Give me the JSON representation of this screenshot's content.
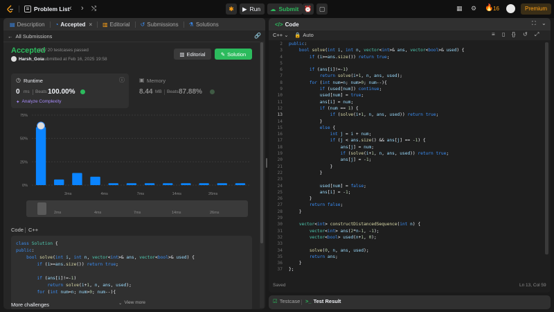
{
  "nav": {
    "problem_list": "Problem List",
    "run": "Run",
    "submit": "Submit",
    "streak": "16",
    "premium": "Premium"
  },
  "left_tabs": [
    {
      "label": "Description"
    },
    {
      "label": "Accepted"
    },
    {
      "label": "Editorial"
    },
    {
      "label": "Submissions"
    },
    {
      "label": "Solutions"
    }
  ],
  "submission": {
    "back_label": "All Submissions",
    "status": "Accepted",
    "testcases": "20 / 20 testcases passed",
    "user": "Harsh_Goia",
    "submitted_at": "submitted at Feb 16, 2025 19:58",
    "editorial_btn": "Editorial",
    "solution_btn": "Solution",
    "runtime_label": "Runtime",
    "runtime_value": "0",
    "runtime_unit": "ms",
    "beats_label": "Beats",
    "runtime_beats": "100.00%",
    "analyze": "Analyze Complexity",
    "memory_label": "Memory",
    "memory_value": "8.44",
    "memory_unit": "MB",
    "memory_beats": "87.88%"
  },
  "chart_data": {
    "type": "bar",
    "yticks": [
      "75%",
      "50%",
      "25%",
      "0%"
    ],
    "ylim": [
      0,
      75
    ],
    "values": [
      62,
      6,
      13,
      9,
      2,
      2,
      2,
      2,
      2,
      2,
      2,
      2
    ],
    "xtick_labels": [
      "2ms",
      "4ms",
      "7ms",
      "14ms",
      "26ms"
    ],
    "highlight_index": 0,
    "bar_color": "#0a84ff"
  },
  "mini_chart": {
    "labels": [
      "2ms",
      "4ms",
      "7ms",
      "14ms",
      "26ms"
    ]
  },
  "code_section": {
    "label": "Code",
    "lang": "C++",
    "view_more": "View more",
    "more_challenges": "More challenges"
  },
  "preview_lines": [
    "class Solution {",
    "public:",
    "    bool solve(int i, int n, vector<int>& ans, vector<bool>& used) {",
    "        if (i>=ans.size()) return true;",
    "",
    "        if (ans[i]!=-1)",
    "            return solve(i+1, n, ans, used);",
    "        for (int num=n; num>0; num--){"
  ],
  "editor": {
    "title": "Code",
    "lang": "C++",
    "mode": "Auto",
    "status_left": "Saved",
    "status_right": "Ln 13, Col 59",
    "current_line": 13,
    "first_line": 2,
    "lines": [
      "public:",
      "    bool solve(int i, int n, vector<int>& ans, vector<bool>& used) {",
      "        if (i>=ans.size()) return true;",
      "",
      "        if (ans[i]!=-1)",
      "            return solve(i+1, n, ans, used);",
      "        for (int num=n; num>0; num--){",
      "            if (used[num]) continue;",
      "            used[num] = true;",
      "            ans[i] = num;",
      "            if (num == 1) {",
      "                if (solve(i+1, n, ans, used)) return true;",
      "            }",
      "            else {",
      "                int j = i + num;",
      "                if (j < ans.size() && ans[j] == -1) {",
      "                    ans[j] = num;",
      "                    if (solve(i+1, n, ans, used)) return true;",
      "                    ans[j] = -1;",
      "                }",
      "            }",
      "",
      "            used[num] = false;",
      "            ans[i] = -1;",
      "        }",
      "        return false;",
      "    }",
      "",
      "    vector<int> constructDistancedSequence(int n) {",
      "        vector<int> ans(2*n-1, -1);",
      "        vector<bool> used(n+1, 0);",
      "",
      "        solve(0, n, ans, used);",
      "        return ans;",
      "    }",
      "};"
    ]
  },
  "bottom_tabs": {
    "testcase": "Testcase",
    "result": "Test Result"
  }
}
